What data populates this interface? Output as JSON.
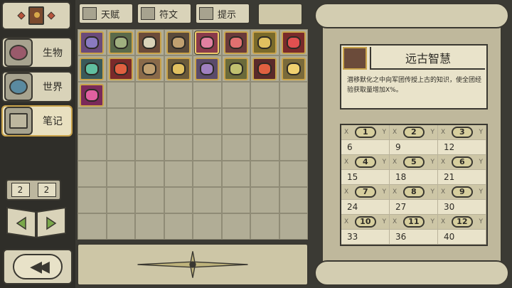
{
  "sidebar": {
    "categories": [
      {
        "label": "生物"
      },
      {
        "label": "世界"
      },
      {
        "label": "笔记"
      }
    ],
    "pages": [
      "2",
      "2"
    ]
  },
  "tabs": [
    {
      "label": "天赋",
      "icon": "talent-icon"
    },
    {
      "label": "符文",
      "icon": "rune-icon"
    },
    {
      "label": "提示",
      "icon": "hint-icon"
    }
  ],
  "grid_items": [
    "spiral",
    "terrain",
    "altar",
    "warrior",
    "creature-red",
    "mask",
    "bell",
    "totem",
    "feather",
    "demon",
    "wood",
    "statue",
    "orb",
    "egg",
    "flame",
    "yellow-blob",
    "jellyfish"
  ],
  "detail": {
    "title": "远古智慧",
    "description": "潜移默化之中向军团传授上古的知识，使全团经验获取量增加X%。",
    "table": {
      "header_x": "X",
      "header_y": "Y",
      "rows": [
        {
          "levels": [
            "1",
            "2",
            "3"
          ],
          "values": [
            "6",
            "9",
            "12"
          ]
        },
        {
          "levels": [
            "4",
            "5",
            "6"
          ],
          "values": [
            "15",
            "18",
            "21"
          ]
        },
        {
          "levels": [
            "7",
            "8",
            "9"
          ],
          "values": [
            "24",
            "27",
            "30"
          ]
        },
        {
          "levels": [
            "10",
            "11",
            "12"
          ],
          "values": [
            "33",
            "36",
            "40"
          ]
        }
      ]
    }
  },
  "colors": {
    "accent_gold": "#c9a34a",
    "parchment": "#e9e3ca",
    "dark_frame": "#3a3831"
  }
}
